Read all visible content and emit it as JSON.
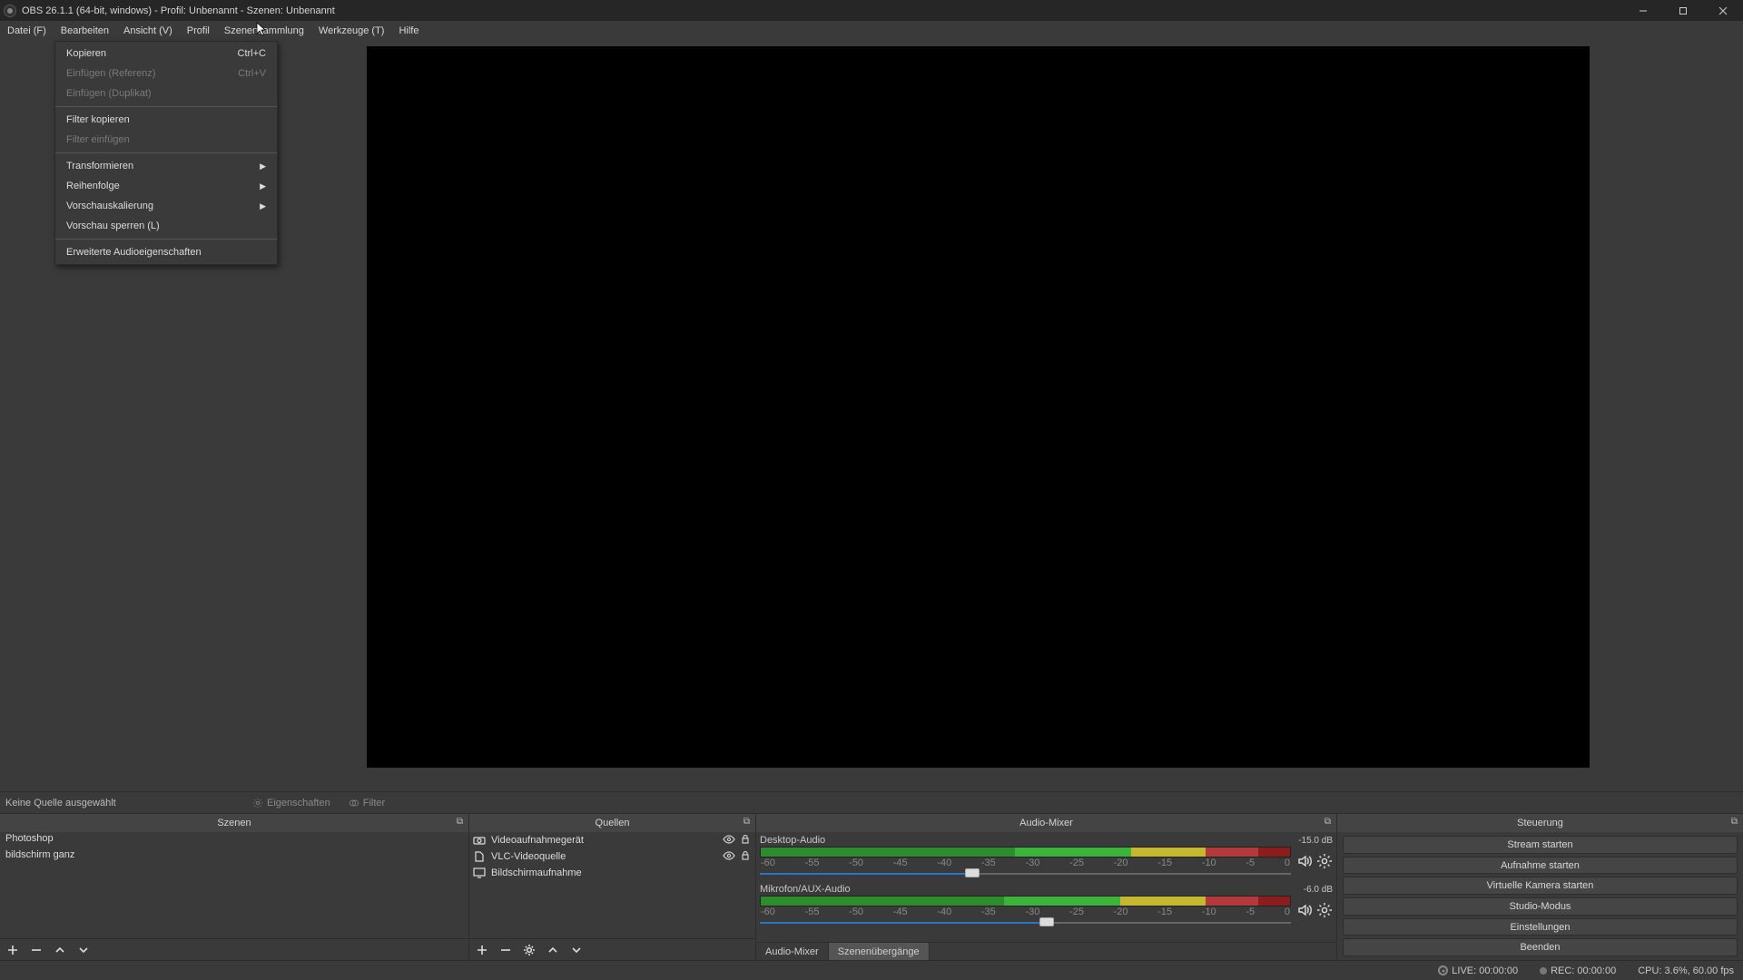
{
  "window": {
    "title": "OBS 26.1.1 (64-bit, windows) - Profil: Unbenannt - Szenen: Unbenannt"
  },
  "menu": {
    "items": [
      "Datei (F)",
      "Bearbeiten",
      "Ansicht (V)",
      "Profil",
      "Szenensammlung",
      "Werkzeuge (T)",
      "Hilfe"
    ]
  },
  "context": {
    "copy": "Kopieren",
    "copy_sc": "Ctrl+C",
    "paste_ref": "Einfügen (Referenz)",
    "paste_ref_sc": "Ctrl+V",
    "paste_dup": "Einfügen (Duplikat)",
    "filter_copy": "Filter kopieren",
    "filter_paste": "Filter einfügen",
    "transform": "Transformieren",
    "order": "Reihenfolge",
    "scale": "Vorschauskalierung",
    "lock": "Vorschau sperren (L)",
    "adv_audio": "Erweiterte Audioeigenschaften"
  },
  "selbar": {
    "text": "Keine Quelle ausgewählt",
    "props": "Eigenschaften",
    "filter": "Filter"
  },
  "docks": {
    "scenes": {
      "title": "Szenen",
      "items": [
        "Photoshop",
        "bildschirm ganz"
      ]
    },
    "sources": {
      "title": "Quellen",
      "items": [
        "Videoaufnahmegerät",
        "VLC-Videoquelle",
        "Bildschirmaufnahme"
      ]
    },
    "mixer": {
      "title": "Audio-Mixer",
      "ch": [
        {
          "name": "Desktop-Audio",
          "db": "-15.0 dB",
          "slider": 40
        },
        {
          "name": "Mikrofon/AUX-Audio",
          "db": "-6.0 dB",
          "slider": 54
        }
      ],
      "ticks": [
        "-60",
        "-55",
        "-50",
        "-45",
        "-40",
        "-35",
        "-30",
        "-25",
        "-20",
        "-15",
        "-10",
        "-5",
        "0"
      ],
      "tab1": "Audio-Mixer",
      "tab2": "Szenenübergänge"
    },
    "control": {
      "title": "Steuerung",
      "btns": [
        "Stream starten",
        "Aufnahme starten",
        "Virtuelle Kamera starten",
        "Studio-Modus",
        "Einstellungen",
        "Beenden"
      ]
    }
  },
  "status": {
    "live": "LIVE: 00:00:00",
    "rec": "REC: 00:00:00",
    "cpu": "CPU: 3.6%, 60.00 fps"
  }
}
